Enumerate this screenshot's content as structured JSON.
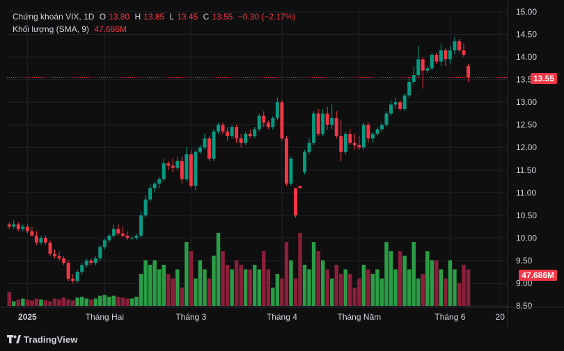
{
  "legend": {
    "symbol": "Chứng khoán VIX, 1D",
    "open_label": "O",
    "open": "13.80",
    "high_label": "H",
    "high": "13.85",
    "low_label": "L",
    "low": "13.45",
    "close_label": "C",
    "close": "13.55",
    "change": "−0.30 (−2.17%)",
    "volume_label": "Khối lượng (SMA, 9)",
    "volume_value": "47.686M"
  },
  "tags": {
    "last_price": "13.55",
    "last_volume": "47.686M"
  },
  "footer": {
    "brand": "TradingView",
    "logo_icon": "tradingview-logo-icon"
  },
  "colors": {
    "up": "#089981",
    "down": "#f23645",
    "up_bar": "#2a9d46",
    "down_bar": "#8b1f3a",
    "background": "#0f0f10",
    "grid": "#1f2229",
    "text": "#d1d4dc"
  },
  "chart_data": {
    "type": "candlestick",
    "title": "Chứng khoán VIX, 1D",
    "price_axis": {
      "ylim": [
        8.5,
        15.0
      ],
      "ticks": [
        "15.00",
        "14.50",
        "14.00",
        "13.50",
        "13.00",
        "12.50",
        "12.00",
        "11.50",
        "11.00",
        "10.50",
        "10.00",
        "9.50",
        "9.00",
        "8.50"
      ]
    },
    "time_axis": {
      "labels": [
        {
          "text": "2025",
          "index": 4
        },
        {
          "text": "Tháng Hai",
          "index": 21
        },
        {
          "text": "Tháng 3",
          "index": 40
        },
        {
          "text": "Tháng 4",
          "index": 60
        },
        {
          "text": "Tháng Năm",
          "index": 77
        },
        {
          "text": "Tháng 6",
          "index": 97
        },
        {
          "text": "20",
          "index": 108
        }
      ],
      "bar_count": 110
    },
    "last_price_line": 13.55,
    "ohlc": [
      [
        10.3,
        10.35,
        10.2,
        10.25
      ],
      [
        10.25,
        10.4,
        10.2,
        10.3
      ],
      [
        10.3,
        10.35,
        10.15,
        10.2
      ],
      [
        10.2,
        10.3,
        10.15,
        10.25
      ],
      [
        10.25,
        10.3,
        10.1,
        10.15
      ],
      [
        10.15,
        10.25,
        10.05,
        10.05
      ],
      [
        10.05,
        10.15,
        9.85,
        9.9
      ],
      [
        9.9,
        10.05,
        9.85,
        10.0
      ],
      [
        10.0,
        10.05,
        9.85,
        9.9
      ],
      [
        9.9,
        9.95,
        9.6,
        9.65
      ],
      [
        9.65,
        9.75,
        9.55,
        9.6
      ],
      [
        9.6,
        9.7,
        9.5,
        9.55
      ],
      [
        9.55,
        9.6,
        9.4,
        9.45
      ],
      [
        9.45,
        9.5,
        9.05,
        9.1
      ],
      [
        9.1,
        9.2,
        9.0,
        9.05
      ],
      [
        9.05,
        9.3,
        9.0,
        9.25
      ],
      [
        9.25,
        9.45,
        9.2,
        9.4
      ],
      [
        9.4,
        9.55,
        9.35,
        9.5
      ],
      [
        9.5,
        9.55,
        9.4,
        9.45
      ],
      [
        9.45,
        9.6,
        9.4,
        9.55
      ],
      [
        9.55,
        9.85,
        9.5,
        9.8
      ],
      [
        9.8,
        10.0,
        9.75,
        9.95
      ],
      [
        9.95,
        10.1,
        9.9,
        10.05
      ],
      [
        10.05,
        10.3,
        10.0,
        10.2
      ],
      [
        10.2,
        10.3,
        10.05,
        10.1
      ],
      [
        10.1,
        10.25,
        10.0,
        10.05
      ],
      [
        10.05,
        10.15,
        9.95,
        10.0
      ],
      [
        10.0,
        10.05,
        9.95,
        10.0
      ],
      [
        10.0,
        10.1,
        9.95,
        10.05
      ],
      [
        10.05,
        10.6,
        10.0,
        10.5
      ],
      [
        10.5,
        10.95,
        10.45,
        10.85
      ],
      [
        10.85,
        11.2,
        10.8,
        11.1
      ],
      [
        11.1,
        11.25,
        11.0,
        11.2
      ],
      [
        11.2,
        11.35,
        11.1,
        11.3
      ],
      [
        11.3,
        11.75,
        11.25,
        11.65
      ],
      [
        11.65,
        11.7,
        11.5,
        11.6
      ],
      [
        11.6,
        11.75,
        11.45,
        11.55
      ],
      [
        11.55,
        11.8,
        11.5,
        11.7
      ],
      [
        11.7,
        11.8,
        11.2,
        11.3
      ],
      [
        11.3,
        12.0,
        11.25,
        11.85
      ],
      [
        11.85,
        11.95,
        11.1,
        11.15
      ],
      [
        11.15,
        11.95,
        11.05,
        11.9
      ],
      [
        11.9,
        12.05,
        11.85,
        12.0
      ],
      [
        12.0,
        12.3,
        11.95,
        12.2
      ],
      [
        12.2,
        12.25,
        11.7,
        11.75
      ],
      [
        11.75,
        12.4,
        11.7,
        12.35
      ],
      [
        12.35,
        12.55,
        12.3,
        12.5
      ],
      [
        12.5,
        12.55,
        12.3,
        12.35
      ],
      [
        12.35,
        12.45,
        12.15,
        12.25
      ],
      [
        12.25,
        12.5,
        12.2,
        12.45
      ],
      [
        12.45,
        12.5,
        12.1,
        12.2
      ],
      [
        12.2,
        12.3,
        12.0,
        12.1
      ],
      [
        12.1,
        12.35,
        12.05,
        12.3
      ],
      [
        12.3,
        12.4,
        12.2,
        12.25
      ],
      [
        12.25,
        12.45,
        12.2,
        12.4
      ],
      [
        12.4,
        12.75,
        12.35,
        12.7
      ],
      [
        12.7,
        12.8,
        12.45,
        12.55
      ],
      [
        12.55,
        12.6,
        12.4,
        12.45
      ],
      [
        12.45,
        12.7,
        12.4,
        12.65
      ],
      [
        12.65,
        13.1,
        12.6,
        13.0
      ],
      [
        13.0,
        13.05,
        12.15,
        12.2
      ],
      [
        12.2,
        12.25,
        11.15,
        11.2
      ],
      [
        11.2,
        11.8,
        11.15,
        11.75
      ],
      [
        11.1,
        11.1,
        10.45,
        10.5
      ],
      [
        11.15,
        11.15,
        11.1,
        11.1
      ],
      [
        11.45,
        11.95,
        11.4,
        11.9
      ],
      [
        11.9,
        12.2,
        11.85,
        12.1
      ],
      [
        12.1,
        12.8,
        12.05,
        12.75
      ],
      [
        12.75,
        12.85,
        12.25,
        12.3
      ],
      [
        12.3,
        12.85,
        12.25,
        12.75
      ],
      [
        12.75,
        12.9,
        12.4,
        12.5
      ],
      [
        12.5,
        12.95,
        12.4,
        12.65
      ],
      [
        12.65,
        12.8,
        12.2,
        12.25
      ],
      [
        12.25,
        12.6,
        11.7,
        11.9
      ],
      [
        11.9,
        12.35,
        11.85,
        12.3
      ],
      [
        12.3,
        12.4,
        12.05,
        12.1
      ],
      [
        12.1,
        12.3,
        11.95,
        12.05
      ],
      [
        12.05,
        12.25,
        11.95,
        12.0
      ],
      [
        12.0,
        12.55,
        11.95,
        12.5
      ],
      [
        12.5,
        12.55,
        12.1,
        12.2
      ],
      [
        12.2,
        12.35,
        12.1,
        12.3
      ],
      [
        12.3,
        12.45,
        12.25,
        12.4
      ],
      [
        12.4,
        12.55,
        12.35,
        12.5
      ],
      [
        12.5,
        12.8,
        12.45,
        12.75
      ],
      [
        12.75,
        13.05,
        12.7,
        12.95
      ],
      [
        12.95,
        13.1,
        12.85,
        13.0
      ],
      [
        13.0,
        13.05,
        12.8,
        12.85
      ],
      [
        12.85,
        13.2,
        12.8,
        13.15
      ],
      [
        13.15,
        13.55,
        13.1,
        13.45
      ],
      [
        13.45,
        13.8,
        13.4,
        13.6
      ],
      [
        13.6,
        14.25,
        13.55,
        13.95
      ],
      [
        13.95,
        14.0,
        13.3,
        13.7
      ],
      [
        13.7,
        13.8,
        13.65,
        13.75
      ],
      [
        13.75,
        14.1,
        13.7,
        14.05
      ],
      [
        14.05,
        14.1,
        13.85,
        13.9
      ],
      [
        13.9,
        14.3,
        13.8,
        14.15
      ],
      [
        14.15,
        14.2,
        13.8,
        13.95
      ],
      [
        13.95,
        14.25,
        13.85,
        14.15
      ],
      [
        14.15,
        14.45,
        14.05,
        14.35
      ],
      [
        14.35,
        14.4,
        14.1,
        14.15
      ],
      [
        14.15,
        14.3,
        14.0,
        14.05
      ],
      [
        13.8,
        13.85,
        13.45,
        13.55
      ]
    ],
    "volume_millions": [
      30,
      10,
      14,
      16,
      14,
      12,
      16,
      14,
      12,
      10,
      16,
      14,
      18,
      14,
      12,
      18,
      20,
      16,
      14,
      16,
      22,
      24,
      20,
      22,
      20,
      18,
      16,
      16,
      20,
      70,
      100,
      90,
      100,
      80,
      90,
      70,
      60,
      80,
      40,
      140,
      120,
      60,
      100,
      80,
      60,
      110,
      160,
      120,
      90,
      80,
      100,
      90,
      80,
      80,
      90,
      80,
      120,
      80,
      40,
      70,
      60,
      140,
      100,
      60,
      160,
      90,
      80,
      140,
      120,
      100,
      80,
      60,
      90,
      70,
      80,
      70,
      40,
      60,
      90,
      80,
      70,
      80,
      60,
      140,
      120,
      80,
      120,
      110,
      80,
      140,
      60,
      70,
      120,
      100,
      100,
      80,
      60,
      100,
      80,
      50,
      90,
      80
    ]
  }
}
